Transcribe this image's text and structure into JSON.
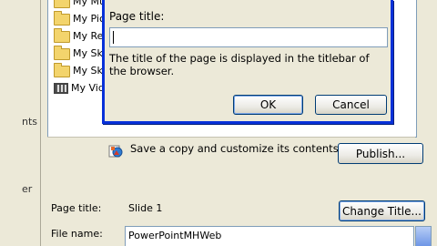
{
  "background": {
    "left_labels": [
      "nts",
      "er"
    ],
    "folders": [
      {
        "label": "My Mus",
        "icon": "folder-icon"
      },
      {
        "label": "My Pict",
        "icon": "folder-icon"
      },
      {
        "label": "My Rec",
        "icon": "folder-icon"
      },
      {
        "label": "My Sky",
        "icon": "folder-icon"
      },
      {
        "label": "My Sky",
        "icon": "folder-icon"
      },
      {
        "label": "My Vide",
        "icon": "film-folder-icon"
      }
    ],
    "publish_text": "Save a copy and customize its contents",
    "publish_button": "Publish...",
    "page_title_label": "Page title:",
    "page_title_value": "Slide 1",
    "change_title_button": "Change Title...",
    "file_name_label": "File name:",
    "file_name_value": "PowerPointMHWeb"
  },
  "dialog": {
    "field_label": "Page title:",
    "field_value": "",
    "description": "The title of the page is displayed in the titlebar of the browser.",
    "ok_label": "OK",
    "cancel_label": "Cancel"
  },
  "colors": {
    "dialog_border": "#0831d9",
    "window_face": "#ece9d8",
    "field_border": "#7f9db9"
  }
}
